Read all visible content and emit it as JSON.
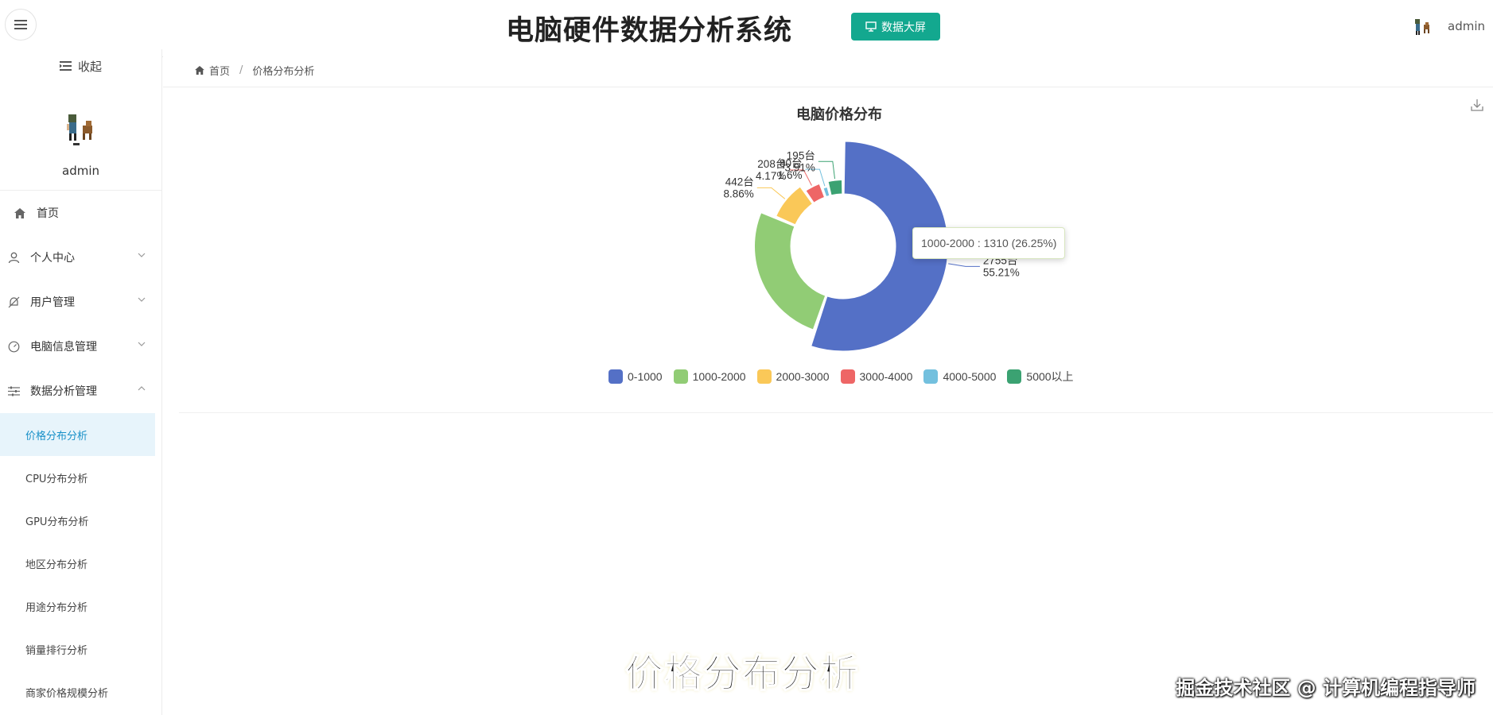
{
  "header": {
    "title": "电脑硬件数据分析系统",
    "screen_button": "数据大屏",
    "username": "admin"
  },
  "sidebar": {
    "collapse_label": "收起",
    "profile_name": "admin",
    "items": [
      {
        "label": "首页"
      },
      {
        "label": "个人中心"
      },
      {
        "label": "用户管理"
      },
      {
        "label": "电脑信息管理"
      },
      {
        "label": "数据分析管理"
      }
    ],
    "sub_items": [
      {
        "label": "价格分布分析"
      },
      {
        "label": "CPU分布分析"
      },
      {
        "label": "GPU分布分析"
      },
      {
        "label": "地区分布分析"
      },
      {
        "label": "用途分布分析"
      },
      {
        "label": "销量排行分析"
      },
      {
        "label": "商家价格规模分析"
      }
    ]
  },
  "breadcrumb": {
    "home": "首页",
    "separator": "/",
    "current": "价格分布分析"
  },
  "chart_data": {
    "type": "pie",
    "variant": "rose",
    "title": "电脑价格分布",
    "categories": [
      "0-1000",
      "1000-2000",
      "2000-3000",
      "3000-4000",
      "4000-5000",
      "5000以上"
    ],
    "values": [
      2755,
      1310,
      442,
      208,
      80,
      195
    ],
    "percentages": [
      55.21,
      26.25,
      8.86,
      4.17,
      1.6,
      3.91
    ],
    "colors": [
      "#5470c6",
      "#91cc75",
      "#fac858",
      "#ee6666",
      "#73c0de",
      "#3ba272"
    ],
    "data_labels": [
      {
        "count": "2755台",
        "pct": "55.21%"
      },
      {
        "count": "",
        "pct": ""
      },
      {
        "count": "442台",
        "pct": "8.86%"
      },
      {
        "count": "208台",
        "pct": "4.17%"
      },
      {
        "count": "80台",
        "pct": "1.6%"
      },
      {
        "count": "195台",
        "pct": "3.91%"
      }
    ],
    "legend_position": "bottom"
  },
  "tooltip": {
    "text": "1000-2000 : 1310 (26.25%)"
  },
  "overlay": {
    "caption": "价格分布分析",
    "watermark": "掘金技术社区 @ 计算机编程指导师"
  }
}
